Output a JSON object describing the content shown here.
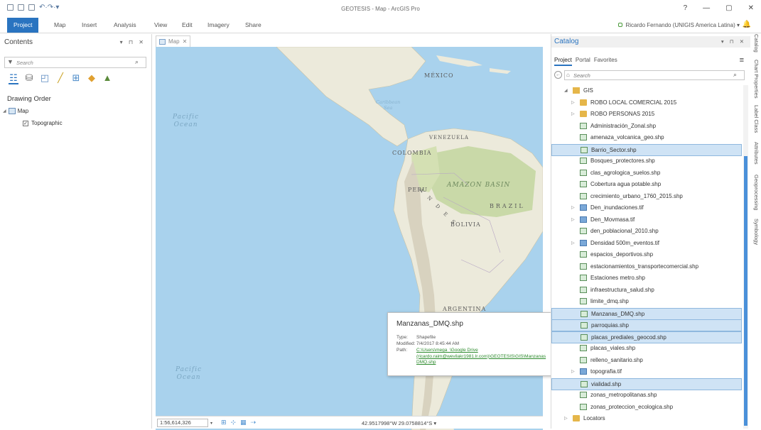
{
  "app": {
    "title": "GEOTESIS - Map - ArcGIS Pro"
  },
  "window_controls": {
    "help": "?",
    "minimize": "—",
    "restore": "▢",
    "close": "✕"
  },
  "ribbon": {
    "tabs": [
      "Project",
      "Map",
      "Insert",
      "Analysis",
      "View",
      "Edit",
      "Imagery",
      "Share"
    ],
    "active_tab": "Project",
    "user": "Ricardo Fernando (UNIGIS America Latina)",
    "user_dropdown": "▾"
  },
  "contents": {
    "title": "Contents",
    "controls": "▾ ⊓ ✕",
    "search_placeholder": "Search",
    "heading": "Drawing Order",
    "map_label": "Map",
    "layer_label": "Topographic"
  },
  "map": {
    "tab_label": "Map",
    "labels": {
      "mexico": "MÉXICO",
      "venezuela": "VENEZUELA",
      "colombia": "COLOMBIA",
      "peru": "PERU",
      "brazil": "BRAZIL",
      "bolivia": "BOLIVIA",
      "argentina": "ARGENTINA",
      "amazon": "AMAZON BASIN",
      "andes": "A N D E S",
      "caribbean_1": "Caribbean",
      "caribbean_2": "Sea",
      "pacific_top_1": "Pacific",
      "pacific_top_2": "Ocean",
      "pacific_bottom_1": "Pacific",
      "pacific_bottom_2": "Ocean"
    },
    "colors": {
      "ocean": "#a9d2ed",
      "land": "#eceadb",
      "forest": "#c9d9a8"
    }
  },
  "status": {
    "scale": "1:56,614,326",
    "coordinates": "42.9517998°W 29.0758814°S"
  },
  "tooltip": {
    "title": "Manzanas_DMQ.shp",
    "type_key": "Type:",
    "type_val": "Shapefile",
    "modified_key": "Modified:",
    "modified_val": "7/4/2017 8:45:44 AM",
    "path_key": "Path:",
    "path_val": "C:\\Users\\mega_\\Google Drive (ricardo.raim@wevilakr1981.lr.com)\\GEOTESIS\\GIS\\Manzanas DMQ.shp"
  },
  "catalog": {
    "title": "Catalog",
    "controls": "▾ ⊓ ✕",
    "tabs": [
      "Project",
      "Portal",
      "Favorites"
    ],
    "active_tab": "Project",
    "search_placeholder": "Search",
    "items": [
      {
        "label": "GIS",
        "kind": "gis",
        "indent": 0,
        "expander": "◢",
        "highlight": false
      },
      {
        "label": "ROBO LOCAL COMERCIAL 2015",
        "kind": "folder",
        "indent": 1,
        "expander": "▷",
        "highlight": false
      },
      {
        "label": "ROBO PERSONAS 2015",
        "kind": "folder",
        "indent": 1,
        "expander": "▷",
        "highlight": false
      },
      {
        "label": "Administración_Zonal.shp",
        "kind": "shp",
        "indent": 1,
        "expander": "",
        "highlight": false
      },
      {
        "label": "amenaza_volcanica_geo.shp",
        "kind": "shp",
        "indent": 1,
        "expander": "",
        "highlight": false
      },
      {
        "label": "Barrio_Sector.shp",
        "kind": "shp",
        "indent": 1,
        "expander": "",
        "highlight": true
      },
      {
        "label": "Bosques_protectores.shp",
        "kind": "shp",
        "indent": 1,
        "expander": "",
        "highlight": false
      },
      {
        "label": "clas_agrologica_suelos.shp",
        "kind": "shp",
        "indent": 1,
        "expander": "",
        "highlight": false
      },
      {
        "label": "Cobertura agua potable.shp",
        "kind": "shp",
        "indent": 1,
        "expander": "",
        "highlight": false
      },
      {
        "label": "crecimiento_urbano_1760_2015.shp",
        "kind": "shp",
        "indent": 1,
        "expander": "",
        "highlight": false
      },
      {
        "label": "Den_inundaciones.tif",
        "kind": "tif",
        "indent": 1,
        "expander": "▷",
        "highlight": false
      },
      {
        "label": "Den_Movmasa.tif",
        "kind": "tif",
        "indent": 1,
        "expander": "▷",
        "highlight": false
      },
      {
        "label": "den_poblacional_2010.shp",
        "kind": "shp",
        "indent": 1,
        "expander": "",
        "highlight": false
      },
      {
        "label": "Densidad 500m_eventos.tif",
        "kind": "tif",
        "indent": 1,
        "expander": "▷",
        "highlight": false
      },
      {
        "label": "espacios_deportivos.shp",
        "kind": "shp",
        "indent": 1,
        "expander": "",
        "highlight": false
      },
      {
        "label": "estacionamientos_transportecomercial.shp",
        "kind": "shp",
        "indent": 1,
        "expander": "",
        "highlight": false
      },
      {
        "label": "Estaciones metro.shp",
        "kind": "shp",
        "indent": 1,
        "expander": "",
        "highlight": false
      },
      {
        "label": "infraestructura_salud.shp",
        "kind": "shp",
        "indent": 1,
        "expander": "",
        "highlight": false
      },
      {
        "label": "limite_dmq.shp",
        "kind": "shp",
        "indent": 1,
        "expander": "",
        "highlight": false
      },
      {
        "label": "Manzanas_DMQ.shp",
        "kind": "shp",
        "indent": 1,
        "expander": "",
        "highlight": true
      },
      {
        "label": "parroquias.shp",
        "kind": "shp",
        "indent": 1,
        "expander": "",
        "highlight": true
      },
      {
        "label": "placas_prediales_geocod.shp",
        "kind": "shp",
        "indent": 1,
        "expander": "",
        "highlight": true
      },
      {
        "label": "placas_viales.shp",
        "kind": "shp",
        "indent": 1,
        "expander": "",
        "highlight": false
      },
      {
        "label": "relleno_sanitario.shp",
        "kind": "shp",
        "indent": 1,
        "expander": "",
        "highlight": false
      },
      {
        "label": "topografia.tif",
        "kind": "tif",
        "indent": 1,
        "expander": "▷",
        "highlight": false
      },
      {
        "label": "vialidad.shp",
        "kind": "shp",
        "indent": 1,
        "expander": "",
        "highlight": true
      },
      {
        "label": "zonas_metropolitanas.shp",
        "kind": "shp",
        "indent": 1,
        "expander": "",
        "highlight": false
      },
      {
        "label": "zonas_proteccion_ecologica.shp",
        "kind": "shp",
        "indent": 1,
        "expander": "",
        "highlight": false
      },
      {
        "label": "Locators",
        "kind": "folder",
        "indent": 0,
        "expander": "▷",
        "highlight": false
      }
    ]
  },
  "side_tabs": [
    "Catalog",
    "Chart Properties",
    "Label Class",
    "Attributes",
    "Geoprocessing",
    "Symbology"
  ]
}
